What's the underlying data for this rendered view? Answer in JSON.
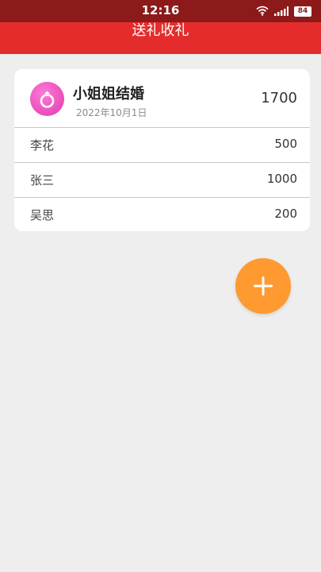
{
  "status_bar": {
    "time": "12:16",
    "battery": "84",
    "icons": [
      "wifi-icon",
      "signal-icon",
      "battery-icon"
    ]
  },
  "nav": {
    "title": "送礼收礼"
  },
  "event": {
    "icon": "ring-icon",
    "title": "小姐姐结婚",
    "date": "2022年10月1日",
    "total": "1700"
  },
  "gifts": [
    {
      "name": "李花",
      "amount": "500"
    },
    {
      "name": "张三",
      "amount": "1000"
    },
    {
      "name": "吴思",
      "amount": "200"
    }
  ],
  "fab": {
    "icon": "plus-icon"
  },
  "colors": {
    "status_bar": "#8c1a1a",
    "nav_bar": "#e52c2c",
    "background": "#eeeeee",
    "fab": "#ff9a30",
    "avatar": "#e03ab0"
  }
}
